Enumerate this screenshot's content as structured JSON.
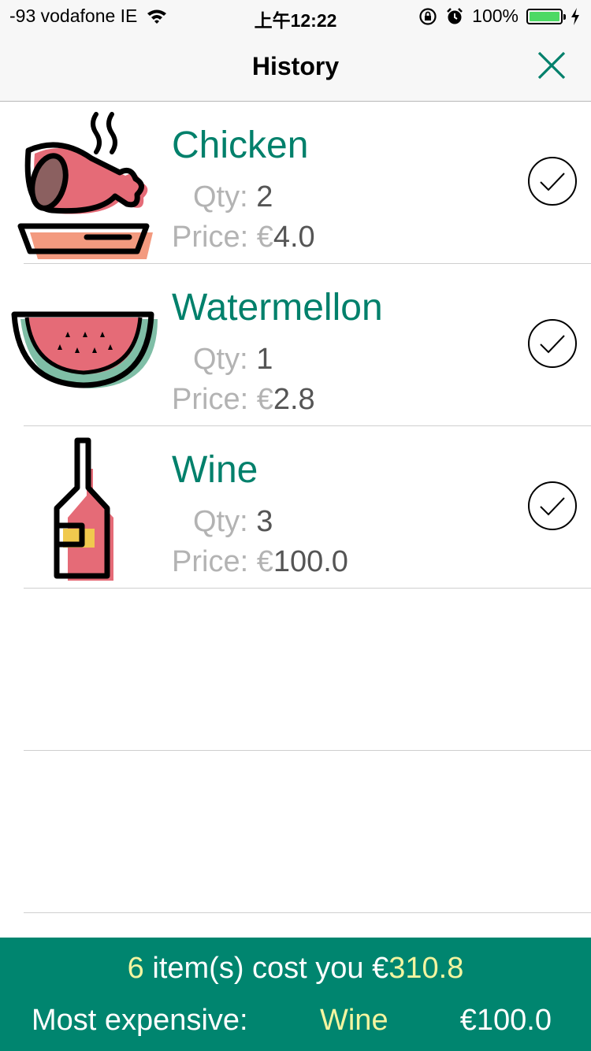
{
  "status_bar": {
    "carrier": "-93 vodafone IE",
    "time": "上午12:22",
    "battery_percent": "100%",
    "battery_level": 1.0,
    "icons": [
      "wifi-icon",
      "rotation-lock-icon",
      "alarm-icon",
      "battery-icon",
      "charging-icon"
    ]
  },
  "nav": {
    "title": "History",
    "close_icon": "close-icon"
  },
  "colors": {
    "accent": "#00806b",
    "footer_bg": "#00856f",
    "highlight": "#f3f5a0",
    "label_gray": "#b3b3b3",
    "value_gray": "#555555"
  },
  "items": [
    {
      "name": "Chicken",
      "qty_label": "Qty:",
      "qty": "2",
      "price_label": "Price: €",
      "price": "4.0",
      "icon": "chicken-icon",
      "checked": true
    },
    {
      "name": "Watermellon",
      "qty_label": "Qty:",
      "qty": "1",
      "price_label": "Price: €",
      "price": "2.8",
      "icon": "watermelon-icon",
      "checked": true
    },
    {
      "name": "Wine",
      "qty_label": "Qty:",
      "qty": "3",
      "price_label": "Price: €",
      "price": "100.0",
      "icon": "wine-bottle-icon",
      "checked": true
    }
  ],
  "footer": {
    "count": "6",
    "cost_text": " item(s) cost you €",
    "total": "310.8",
    "most_expensive_label": "Most expensive:",
    "most_expensive_item": "Wine",
    "most_expensive_price": "€100.0"
  }
}
